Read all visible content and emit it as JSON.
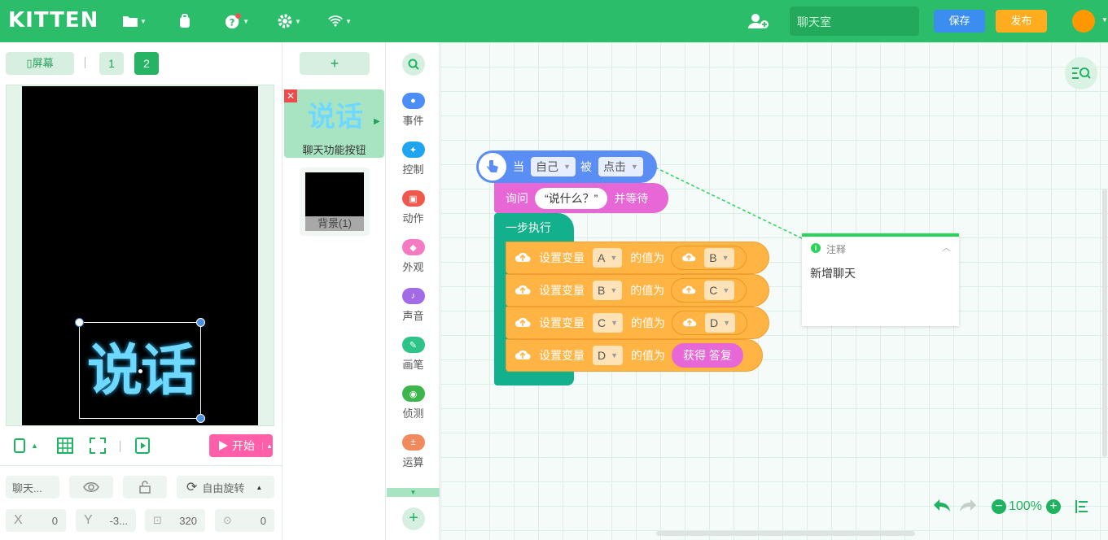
{
  "topbar": {
    "logo": "KITTEN",
    "project_name": "聊天室",
    "save_label": "保存",
    "publish_label": "发布"
  },
  "stage": {
    "screen_label": "屏幕",
    "pages": [
      "1",
      "2"
    ],
    "sprite_text": "说话",
    "start_label": "开始",
    "props": {
      "name": "聊天...",
      "rotation_label": "自由旋转",
      "x_label": "X",
      "x_value": "0",
      "y_label": "Y",
      "y_value": "-3...",
      "size_value": "320",
      "angle_value": "0"
    }
  },
  "sprites": {
    "add_label": "+",
    "items": [
      {
        "name": "聊天功能按钮",
        "thumb_text": "说话"
      },
      {
        "name": "背景(1)"
      }
    ]
  },
  "categories": [
    {
      "label": "事件",
      "color": "#4b8ef5"
    },
    {
      "label": "控制",
      "color": "#1fa5f0"
    },
    {
      "label": "动作",
      "color": "#f0574d"
    },
    {
      "label": "外观",
      "color": "#f47ac2"
    },
    {
      "label": "声音",
      "color": "#a36ae6"
    },
    {
      "label": "画笔",
      "color": "#2dc389"
    },
    {
      "label": "侦测",
      "color": "#3cb54a"
    },
    {
      "label": "运算",
      "color": "#f08a5d"
    }
  ],
  "blocks": {
    "event": {
      "when": "当",
      "target": "自己",
      "by": "被",
      "action": "点击"
    },
    "ask": {
      "label": "询问",
      "question": "说什么？",
      "wait": "并等待"
    },
    "step": {
      "label": "一步执行"
    },
    "set_label": "设置变量",
    "value_label": "的值为",
    "sets": [
      {
        "var": "A",
        "value": "B"
      },
      {
        "var": "B",
        "value": "C"
      },
      {
        "var": "C",
        "value": "D"
      },
      {
        "var": "D",
        "value": "获得 答复"
      }
    ]
  },
  "note": {
    "title": "注释",
    "text": "新增聊天"
  },
  "zoom": {
    "value": "100%"
  },
  "colors": {
    "brand": "#2bbd6a",
    "save": "#3b8ef0",
    "publish": "#ffad1f",
    "event_block": "#5b8ef5",
    "ask_block": "#e667d5",
    "control_block": "#13b08d",
    "data_block": "#ffb443"
  }
}
